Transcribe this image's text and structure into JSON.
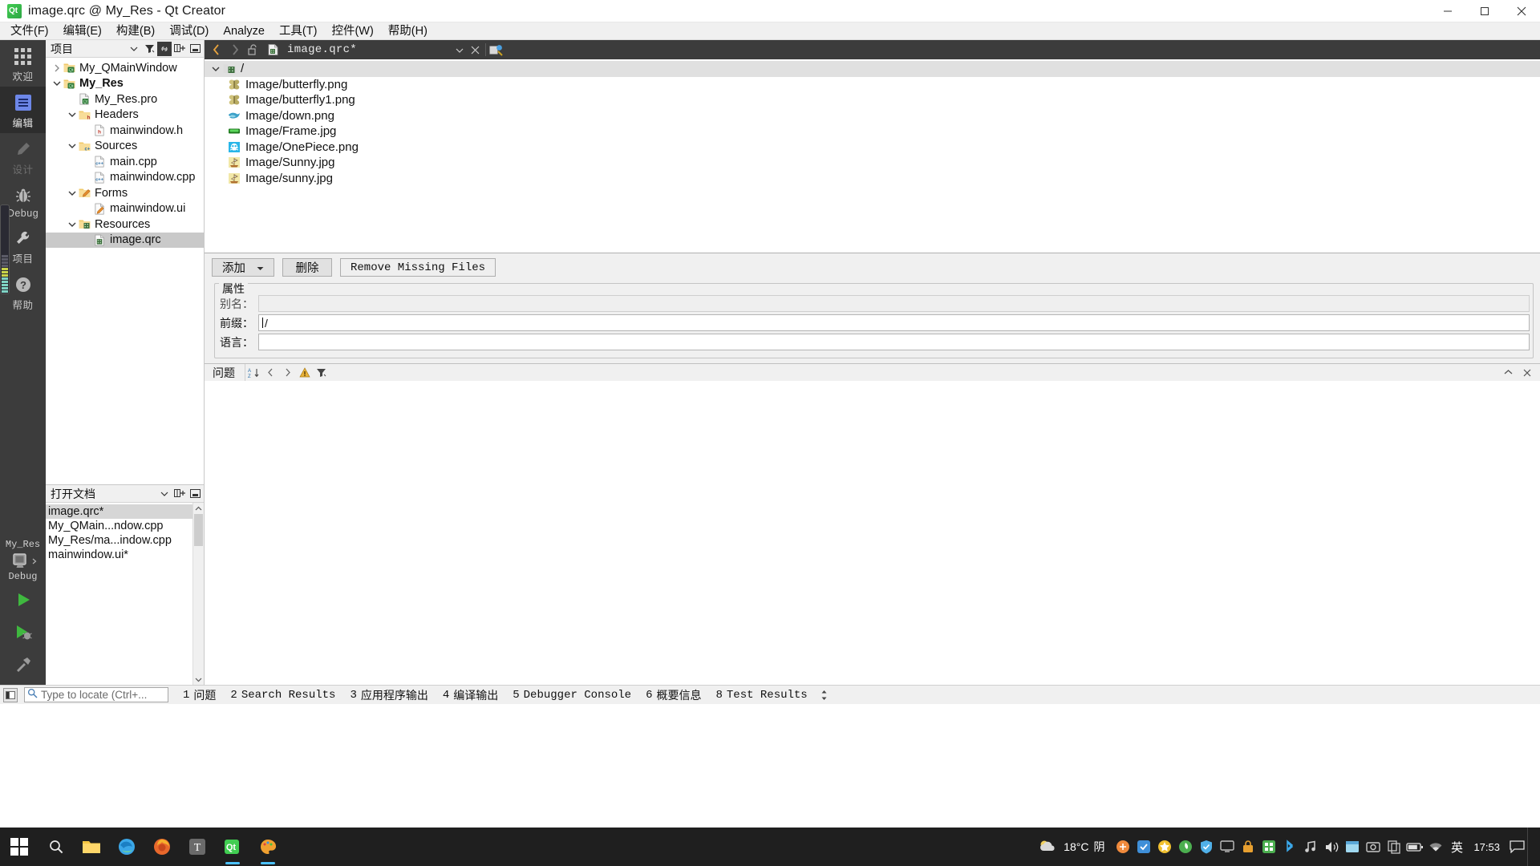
{
  "window": {
    "title": "image.qrc @ My_Res - Qt Creator",
    "app_icon": "qt-logo-icon",
    "minimize_label": "Minimize",
    "maximize_label": "Maximize",
    "close_label": "Close"
  },
  "menubar": {
    "items": [
      {
        "label": "文件(F)",
        "name": "menu-file"
      },
      {
        "label": "编辑(E)",
        "name": "menu-edit"
      },
      {
        "label": "构建(B)",
        "name": "menu-build"
      },
      {
        "label": "调试(D)",
        "name": "menu-debug"
      },
      {
        "label": "Analyze",
        "name": "menu-analyze"
      },
      {
        "label": "工具(T)",
        "name": "menu-tools"
      },
      {
        "label": "控件(W)",
        "name": "menu-window"
      },
      {
        "label": "帮助(H)",
        "name": "menu-help"
      }
    ]
  },
  "modebar": {
    "modes": [
      {
        "label": "欢迎",
        "icon": "grid-icon",
        "state": "normal"
      },
      {
        "label": "编辑",
        "icon": "document-lines-icon",
        "state": "active"
      },
      {
        "label": "设计",
        "icon": "pencil-icon",
        "state": "disabled"
      },
      {
        "label": "Debug",
        "icon": "bug-icon",
        "state": "normal"
      },
      {
        "label": "项目",
        "icon": "wrench-icon",
        "state": "normal"
      },
      {
        "label": "帮助",
        "icon": "question-circle-icon",
        "state": "normal"
      }
    ],
    "kit": {
      "project": "My_Res",
      "config": "Debug",
      "icon": "desktop-icon"
    },
    "run_buttons": [
      {
        "name": "run-button",
        "icon": "play-icon"
      },
      {
        "name": "debug-button",
        "icon": "play-bug-icon"
      },
      {
        "name": "build-button",
        "icon": "hammer-icon"
      }
    ]
  },
  "sidebar": {
    "projects_panel": {
      "title": "项目",
      "tools": [
        {
          "name": "filter-dropdown",
          "icon": "chevron-down-icon"
        },
        {
          "name": "filter-tree",
          "icon": "filter-icon"
        },
        {
          "name": "sync-with-editor",
          "icon": "link-icon",
          "active": true
        },
        {
          "name": "split-panel",
          "icon": "split-add-icon"
        },
        {
          "name": "close-panel",
          "icon": "minimize-panel-icon"
        }
      ],
      "tree": [
        {
          "label": "My_QMainWindow",
          "depth": 0,
          "arrow": "collapsed",
          "icon": "qt-project-icon",
          "bold": false,
          "selected": false
        },
        {
          "label": "My_Res",
          "depth": 0,
          "arrow": "expanded",
          "icon": "qt-project-icon",
          "bold": true,
          "selected": false
        },
        {
          "label": "My_Res.pro",
          "depth": 1,
          "arrow": "none",
          "icon": "pro-file-icon",
          "bold": false,
          "selected": false
        },
        {
          "label": "Headers",
          "depth": 1,
          "arrow": "expanded",
          "icon": "folder-h-icon",
          "bold": false,
          "selected": false
        },
        {
          "label": "mainwindow.h",
          "depth": 2,
          "arrow": "none",
          "icon": "h-file-icon",
          "bold": false,
          "selected": false
        },
        {
          "label": "Sources",
          "depth": 1,
          "arrow": "expanded",
          "icon": "folder-cpp-icon",
          "bold": false,
          "selected": false
        },
        {
          "label": "main.cpp",
          "depth": 2,
          "arrow": "none",
          "icon": "cpp-file-icon",
          "bold": false,
          "selected": false
        },
        {
          "label": "mainwindow.cpp",
          "depth": 2,
          "arrow": "none",
          "icon": "cpp-file-icon",
          "bold": false,
          "selected": false
        },
        {
          "label": "Forms",
          "depth": 1,
          "arrow": "expanded",
          "icon": "folder-ui-icon",
          "bold": false,
          "selected": false
        },
        {
          "label": "mainwindow.ui",
          "depth": 2,
          "arrow": "none",
          "icon": "ui-file-icon",
          "bold": false,
          "selected": false
        },
        {
          "label": "Resources",
          "depth": 1,
          "arrow": "expanded",
          "icon": "folder-qrc-icon",
          "bold": false,
          "selected": false
        },
        {
          "label": "image.qrc",
          "depth": 2,
          "arrow": "none",
          "icon": "qrc-file-icon",
          "bold": false,
          "selected": true
        }
      ]
    },
    "open_documents": {
      "title": "打开文档",
      "tools": [
        {
          "name": "opendocs-dropdown",
          "icon": "chevron-down-icon"
        },
        {
          "name": "opendocs-split",
          "icon": "split-add-icon"
        },
        {
          "name": "opendocs-close",
          "icon": "minimize-panel-icon"
        }
      ],
      "items": [
        {
          "label": "image.qrc*",
          "selected": true
        },
        {
          "label": "My_QMain...ndow.cpp",
          "selected": false
        },
        {
          "label": "My_Res/ma...indow.cpp",
          "selected": false
        },
        {
          "label": "mainwindow.ui*",
          "selected": false
        }
      ]
    }
  },
  "editor": {
    "toolbar": {
      "back_label": "返回",
      "forward_label": "前进",
      "lock_icon": "unlocked-icon",
      "file_icon": "qrc-file-icon",
      "filename": "image.qrc*",
      "dropdown_icon": "chevron-down-icon",
      "close_icon": "close-icon",
      "split_icon": "split-editor-icon"
    },
    "resource_tree": {
      "root": {
        "label": "/",
        "icon": "qrc-prefix-icon",
        "selected": true,
        "arrow": "expanded"
      },
      "files": [
        {
          "label": "Image/butterfly.png",
          "icon": "butterfly-image-icon"
        },
        {
          "label": "Image/butterfly1.png",
          "icon": "butterfly-image-icon"
        },
        {
          "label": "Image/down.png",
          "icon": "bird-image-icon"
        },
        {
          "label": "Image/Frame.jpg",
          "icon": "green-frame-image-icon"
        },
        {
          "label": "Image/OnePiece.png",
          "icon": "skull-image-icon"
        },
        {
          "label": "Image/Sunny.jpg",
          "icon": "ship-image-icon"
        },
        {
          "label": "Image/sunny.jpg",
          "icon": "ship-image-icon"
        }
      ]
    },
    "buttons": {
      "add": "添加",
      "add_caret_icon": "caret-down-icon",
      "remove": "删除",
      "remove_missing": "Remove Missing Files"
    },
    "properties": {
      "legend": "属性",
      "rows": [
        {
          "label": "别名：",
          "value": "",
          "enabled": false,
          "name": "alias-field"
        },
        {
          "label": "前缀：",
          "value": "/",
          "enabled": true,
          "name": "prefix-field"
        },
        {
          "label": "语言：",
          "value": "",
          "enabled": true,
          "name": "language-field"
        }
      ]
    }
  },
  "issues_pane": {
    "title": "问题",
    "tools": [
      {
        "name": "sort-issues",
        "icon": "sort-az-icon"
      },
      {
        "name": "prev-issue",
        "icon": "chevron-left-icon"
      },
      {
        "name": "next-issue",
        "icon": "chevron-right-icon"
      },
      {
        "name": "warning-filter",
        "icon": "warning-icon"
      },
      {
        "name": "filter-issues",
        "icon": "filter-icon"
      }
    ],
    "right_tools": [
      {
        "name": "maximize-output-pane",
        "icon": "chevron-up-icon"
      },
      {
        "name": "close-output-pane",
        "icon": "close-icon"
      }
    ]
  },
  "statusbar": {
    "split_icon": "split-icon",
    "locator": {
      "icon": "search-icon",
      "placeholder": "Type to locate (Ctrl+..."
    },
    "output_tabs": [
      {
        "num": "1",
        "label": "问题"
      },
      {
        "num": "2",
        "label": "Search Results"
      },
      {
        "num": "3",
        "label": "应用程序输出"
      },
      {
        "num": "4",
        "label": "编译输出"
      },
      {
        "num": "5",
        "label": "Debugger Console"
      },
      {
        "num": "6",
        "label": "概要信息"
      },
      {
        "num": "8",
        "label": "Test Results"
      }
    ],
    "more_icon": "updown-arrows-icon"
  },
  "taskbar": {
    "start_icon": "windows-start-icon",
    "pinned": [
      {
        "name": "search-taskbar-icon",
        "icon": "search-icon",
        "color": "#e8e8e8"
      },
      {
        "name": "folder-explorer-icon",
        "icon": "folder-icon",
        "color": "#f5c542"
      },
      {
        "name": "edge-browser-icon",
        "icon": "edge-icon",
        "color": "#3ba7e8"
      },
      {
        "name": "firefox-browser-icon",
        "icon": "firefox-icon",
        "color": "#e8682c"
      },
      {
        "name": "translate-app-icon",
        "icon": "letter-t-icon",
        "color": "#5a5a5a"
      },
      {
        "name": "qt-creator-taskbar-icon",
        "icon": "qt-logo-icon",
        "color": "#41cd52",
        "running": true
      },
      {
        "name": "paint-app-icon",
        "icon": "palette-icon",
        "color": "#f0a030",
        "running": true
      }
    ],
    "weather": {
      "temp": "18°C",
      "desc": "阴",
      "icon": "cloudy-icon"
    },
    "tray": [
      {
        "name": "tray-app-1",
        "icon": "orange-circle-icon",
        "color": "#f08a3c"
      },
      {
        "name": "tray-app-2",
        "icon": "blue-square-icon",
        "color": "#3f8fd8"
      },
      {
        "name": "tray-app-3",
        "icon": "yellow-star-icon",
        "color": "#f0c030"
      },
      {
        "name": "tray-app-4",
        "icon": "green-leaf-icon",
        "color": "#4caf50"
      },
      {
        "name": "tray-app-5",
        "icon": "shield-icon",
        "color": "#50b0e8"
      },
      {
        "name": "tray-app-6",
        "icon": "monitor-icon",
        "color": "#c0c0c0"
      },
      {
        "name": "tray-app-7",
        "icon": "lock-orange-icon",
        "color": "#e8a030"
      },
      {
        "name": "tray-app-8",
        "icon": "grid-green-icon",
        "color": "#4caf50"
      },
      {
        "name": "tray-app-9",
        "icon": "bluetooth-icon",
        "color": "#3ba7e8"
      },
      {
        "name": "tray-app-10",
        "icon": "music-note-icon",
        "color": "#d0d0d0"
      },
      {
        "name": "tray-volume-icon",
        "icon": "speaker-icon",
        "color": "#e0e0e0"
      },
      {
        "name": "tray-app-11",
        "icon": "window-icon",
        "color": "#a0d8f0"
      },
      {
        "name": "tray-app-12",
        "icon": "screenshot-icon",
        "color": "#c8c8c8"
      },
      {
        "name": "tray-app-13",
        "icon": "copy-icon",
        "color": "#c8c8c8"
      },
      {
        "name": "tray-battery-icon",
        "icon": "battery-icon",
        "color": "#e0e0e0"
      },
      {
        "name": "tray-network-icon",
        "icon": "wifi-icon",
        "color": "#e0e0e0"
      },
      {
        "name": "tray-ime-icon",
        "icon": "letter-ying-icon",
        "color": "#ffffff"
      }
    ],
    "ime_label": "英",
    "clock": {
      "time": "17:53",
      "date": ""
    },
    "notification_icon": "speech-bubble-icon"
  }
}
